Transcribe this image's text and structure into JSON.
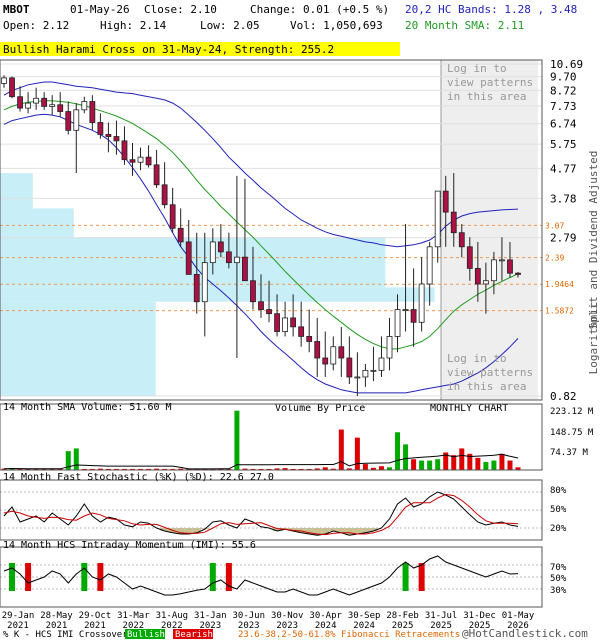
{
  "header": {
    "symbol": "MBOT",
    "date": "01-May-26",
    "close": "Close: 2.10",
    "change": "Change: 0.01 (+0.5 %)",
    "open": "Open: 2.12",
    "high": "High: 2.14",
    "low": "Low: 2.05",
    "vol": "Vol: 1,050,693",
    "bands": "20,2 HC Bands: 1.28 , 3.48",
    "sma": "20 Month SMA: 2.11"
  },
  "colors": {
    "up": "#00aa00",
    "down": "#dd0000",
    "candle_down": "#aa1144",
    "band": "#2222bb",
    "sma": "#229922",
    "volume_zone": "#c8eef8",
    "banner": "#ffff00"
  },
  "banner": "Bullish Harami Cross on 31-May-24, Strength: 255.2",
  "price_panel": {
    "right_label": "Split and Dividend Adjusted",
    "scale_label": "Logarithmic",
    "volume_by_price": "Volume By Price",
    "chart_type": "MONTHLY CHART",
    "pattern_msg_top": [
      "Log in to",
      "view patterns",
      "in this area"
    ],
    "pattern_msg_bottom": [
      "Log in to",
      "view patterns",
      "in this area"
    ],
    "fib_levels": [
      "3.07",
      "2.39",
      "1.9464",
      "1.5872"
    ]
  },
  "volume_panel": {
    "title": "14 Month SMA Volume: 51.60 M",
    "ticks": [
      "223.12 M",
      "148.75 M",
      "74.37 M"
    ]
  },
  "stoch_panel": {
    "title": "14 Month Fast Stochastic (%K) (%D): 22.6   27.0",
    "ticks": [
      "80%",
      "50%",
      "20%"
    ]
  },
  "imi_panel": {
    "title": "14 Month HCS Intraday Momentum (IMI): 55.6",
    "ticks": [
      "70%",
      "50%",
      "30%"
    ]
  },
  "x_labels": [
    [
      "29-Jan",
      "2021"
    ],
    [
      "28-May",
      "2021"
    ],
    [
      "29-Oct",
      "2021"
    ],
    [
      "31-Mar",
      "2022"
    ],
    [
      "31-Aug",
      "2022"
    ],
    [
      "31-Jan",
      "2023"
    ],
    [
      "30-Jun",
      "2023"
    ],
    [
      "30-Nov",
      "2023"
    ],
    [
      "30-Apr",
      "2024"
    ],
    [
      "30-Sep",
      "2024"
    ],
    [
      "28-Feb",
      "2025"
    ],
    [
      "31-Jul",
      "2025"
    ],
    [
      "31-Dec",
      "2025"
    ],
    [
      "01-May",
      "2026"
    ]
  ],
  "footer": {
    "prefix": "% K - HCS IMI Crossover:",
    "bullish": "Bullish",
    "bearish": "Bearish",
    "fib": "23.6-38.2-50-61.8% Fibonacci Retracements",
    "credit": "@HotCandlestick.com"
  },
  "chart_data": {
    "type": "candlestick",
    "yscale": "log",
    "ylim": [
      0.82,
      10.69
    ],
    "y_ticks": [
      10.69,
      9.7,
      8.72,
      7.73,
      6.74,
      5.75,
      4.77,
      3.78,
      2.79,
      0.82
    ],
    "x": [
      "Jan-21",
      "Feb-21",
      "Mar-21",
      "Apr-21",
      "May-21",
      "Jun-21",
      "Jul-21",
      "Aug-21",
      "Sep-21",
      "Oct-21",
      "Nov-21",
      "Dec-21",
      "Jan-22",
      "Feb-22",
      "Mar-22",
      "Apr-22",
      "May-22",
      "Jun-22",
      "Jul-22",
      "Aug-22",
      "Sep-22",
      "Oct-22",
      "Nov-22",
      "Dec-22",
      "Jan-23",
      "Feb-23",
      "Mar-23",
      "Apr-23",
      "May-23",
      "Jun-23",
      "Jul-23",
      "Aug-23",
      "Sep-23",
      "Oct-23",
      "Nov-23",
      "Dec-23",
      "Jan-24",
      "Feb-24",
      "Mar-24",
      "Apr-24",
      "May-24",
      "Jun-24",
      "Jul-24",
      "Aug-24",
      "Sep-24",
      "Oct-24",
      "Nov-24",
      "Dec-24",
      "Jan-25",
      "Feb-25",
      "Mar-25",
      "Apr-25",
      "May-25",
      "Jun-25",
      "Jul-25",
      "Aug-25",
      "Sep-25",
      "Oct-25",
      "Nov-25",
      "Dec-25",
      "Jan-26",
      "Feb-26",
      "Mar-26",
      "Apr-26",
      "May-26"
    ],
    "open": [
      9.2,
      9.6,
      8.3,
      7.6,
      7.9,
      8.2,
      7.7,
      7.8,
      7.4,
      6.4,
      7.5,
      8.0,
      6.8,
      6.2,
      6.1,
      5.9,
      5.1,
      5.0,
      5.2,
      4.9,
      4.2,
      3.6,
      3.0,
      2.7,
      2.1,
      1.7,
      2.3,
      2.7,
      2.5,
      2.3,
      2.4,
      2.0,
      1.7,
      1.6,
      1.55,
      1.35,
      1.5,
      1.4,
      1.3,
      1.25,
      1.1,
      1.05,
      1.2,
      1.1,
      0.95,
      0.95,
      1.0,
      1.0,
      1.1,
      1.3,
      1.6,
      1.6,
      1.45,
      1.95,
      2.6,
      4.0,
      3.4,
      2.9,
      2.6,
      2.2,
      1.95,
      2.0,
      2.35,
      2.35,
      2.12
    ],
    "high": [
      9.8,
      9.7,
      9.0,
      8.6,
      8.9,
      8.6,
      8.4,
      8.6,
      8.0,
      7.9,
      8.3,
      8.4,
      7.3,
      6.8,
      6.9,
      6.6,
      5.8,
      5.6,
      5.7,
      5.5,
      5.0,
      4.1,
      3.5,
      3.2,
      2.9,
      2.9,
      3.0,
      3.1,
      2.9,
      4.5,
      4.4,
      2.6,
      2.1,
      2.0,
      1.8,
      1.7,
      1.8,
      1.7,
      1.6,
      1.5,
      1.35,
      1.3,
      1.4,
      1.3,
      1.15,
      1.05,
      1.2,
      1.3,
      1.5,
      1.8,
      3.1,
      2.2,
      2.4,
      2.7,
      3.1,
      4.5,
      4.6,
      3.1,
      2.8,
      2.7,
      2.3,
      2.5,
      2.8,
      2.7,
      2.14
    ],
    "low": [
      8.9,
      8.2,
      7.4,
      7.3,
      7.5,
      7.5,
      7.2,
      7.1,
      6.2,
      4.6,
      7.3,
      6.4,
      6.0,
      5.4,
      5.3,
      4.9,
      4.5,
      4.7,
      4.8,
      4.1,
      3.5,
      2.9,
      2.6,
      2.1,
      1.55,
      1.3,
      2.1,
      2.4,
      2.2,
      1.1,
      2.3,
      1.6,
      1.5,
      1.45,
      1.3,
      1.3,
      1.3,
      1.2,
      1.15,
      0.95,
      0.95,
      1.0,
      0.95,
      0.9,
      0.82,
      0.88,
      0.92,
      0.95,
      1.0,
      1.15,
      1.35,
      1.2,
      1.35,
      1.65,
      2.3,
      2.6,
      2.6,
      2.4,
      2.0,
      1.7,
      1.55,
      1.8,
      2.0,
      2.05,
      2.05
    ],
    "close": [
      9.6,
      8.3,
      7.6,
      7.9,
      8.2,
      7.7,
      7.8,
      7.4,
      6.4,
      7.5,
      8.0,
      6.8,
      6.2,
      6.1,
      5.9,
      5.1,
      5.0,
      5.2,
      4.9,
      4.2,
      3.6,
      3.0,
      2.7,
      2.1,
      1.7,
      2.3,
      2.7,
      2.5,
      2.3,
      2.4,
      2.0,
      1.7,
      1.6,
      1.55,
      1.35,
      1.5,
      1.4,
      1.3,
      1.25,
      1.1,
      1.05,
      1.2,
      1.1,
      0.95,
      0.95,
      1.0,
      1.0,
      1.1,
      1.3,
      1.6,
      1.6,
      1.45,
      1.95,
      2.6,
      4.0,
      3.4,
      2.9,
      2.6,
      2.2,
      1.95,
      2.0,
      2.35,
      2.35,
      2.12,
      2.1
    ],
    "upper_band": [
      8.4,
      8.7,
      8.9,
      9.1,
      9.2,
      9.3,
      9.3,
      9.2,
      9.1,
      9.0,
      8.95,
      8.9,
      8.8,
      8.7,
      8.6,
      8.55,
      8.5,
      8.4,
      8.3,
      8.2,
      8.1,
      7.9,
      7.6,
      7.2,
      6.8,
      6.4,
      6.0,
      5.6,
      5.2,
      4.9,
      4.6,
      4.35,
      4.1,
      3.9,
      3.7,
      3.5,
      3.35,
      3.2,
      3.1,
      3.0,
      2.92,
      2.86,
      2.82,
      2.78,
      2.74,
      2.7,
      2.68,
      2.64,
      2.62,
      2.6,
      2.62,
      2.64,
      2.68,
      2.74,
      2.86,
      3.05,
      3.2,
      3.3,
      3.36,
      3.4,
      3.42,
      3.44,
      3.46,
      3.47,
      3.48
    ],
    "lower_band": [
      6.7,
      6.9,
      7.0,
      7.1,
      7.2,
      7.25,
      7.2,
      7.1,
      6.9,
      6.7,
      6.55,
      6.4,
      6.2,
      5.95,
      5.6,
      5.2,
      4.8,
      4.4,
      4.0,
      3.6,
      3.25,
      2.9,
      2.6,
      2.4,
      2.2,
      2.05,
      1.95,
      1.85,
      1.75,
      1.65,
      1.55,
      1.45,
      1.35,
      1.27,
      1.2,
      1.14,
      1.08,
      1.02,
      0.97,
      0.93,
      0.9,
      0.88,
      0.86,
      0.85,
      0.84,
      0.84,
      0.84,
      0.84,
      0.84,
      0.84,
      0.84,
      0.85,
      0.86,
      0.87,
      0.88,
      0.89,
      0.9,
      0.92,
      0.95,
      0.98,
      1.02,
      1.07,
      1.13,
      1.2,
      1.28
    ],
    "sma20": [
      7.5,
      7.7,
      7.85,
      7.95,
      8.0,
      8.05,
      8.05,
      8.0,
      7.95,
      7.85,
      7.75,
      7.6,
      7.45,
      7.3,
      7.15,
      6.95,
      6.75,
      6.5,
      6.25,
      6.0,
      5.7,
      5.4,
      5.05,
      4.7,
      4.35,
      4.05,
      3.8,
      3.55,
      3.35,
      3.15,
      2.97,
      2.8,
      2.62,
      2.46,
      2.3,
      2.15,
      2.02,
      1.9,
      1.79,
      1.69,
      1.6,
      1.52,
      1.45,
      1.38,
      1.32,
      1.27,
      1.23,
      1.2,
      1.18,
      1.18,
      1.2,
      1.22,
      1.25,
      1.3,
      1.38,
      1.48,
      1.58,
      1.66,
      1.73,
      1.8,
      1.86,
      1.93,
      1.99,
      2.05,
      2.11
    ],
    "volume_ma_ticks": [
      223.12,
      148.75,
      74.37
    ],
    "volume": [
      5,
      6,
      5,
      4,
      4,
      5,
      4,
      4,
      70,
      80,
      4,
      4,
      5,
      4,
      4,
      4,
      4,
      4,
      4,
      5,
      4,
      4,
      5,
      4,
      4,
      4,
      5,
      5,
      4,
      220,
      5,
      4,
      4,
      4,
      6,
      7,
      4,
      4,
      4,
      6,
      10,
      5,
      150,
      6,
      120,
      22,
      8,
      14,
      10,
      140,
      95,
      40,
      35,
      35,
      40,
      65,
      55,
      80,
      60,
      45,
      30,
      35,
      60,
      35,
      10
    ],
    "volume_up": [
      false,
      true,
      false,
      false,
      false,
      false,
      false,
      false,
      true,
      true,
      false,
      false,
      false,
      false,
      false,
      false,
      false,
      false,
      false,
      false,
      false,
      false,
      false,
      false,
      false,
      false,
      false,
      false,
      false,
      true,
      false,
      false,
      false,
      false,
      false,
      false,
      false,
      false,
      false,
      false,
      false,
      false,
      false,
      false,
      false,
      false,
      false,
      false,
      true,
      true,
      true,
      false,
      true,
      true,
      true,
      false,
      false,
      false,
      false,
      false,
      true,
      true,
      false,
      false,
      false
    ],
    "stoch_k": [
      40,
      55,
      30,
      35,
      40,
      30,
      45,
      35,
      25,
      40,
      60,
      40,
      30,
      38,
      35,
      25,
      22,
      30,
      28,
      20,
      15,
      12,
      10,
      10,
      12,
      18,
      30,
      32,
      25,
      20,
      35,
      30,
      22,
      20,
      15,
      18,
      15,
      12,
      10,
      8,
      10,
      15,
      12,
      8,
      10,
      12,
      15,
      20,
      35,
      60,
      70,
      55,
      60,
      72,
      80,
      75,
      68,
      55,
      42,
      30,
      25,
      28,
      30,
      25,
      22.6
    ],
    "stoch_d": [
      45,
      48,
      45,
      40,
      38,
      36,
      38,
      37,
      34,
      33,
      40,
      45,
      42,
      36,
      34,
      32,
      27,
      25,
      26,
      26,
      21,
      16,
      12,
      11,
      11,
      13,
      20,
      27,
      29,
      26,
      27,
      28,
      29,
      24,
      19,
      18,
      16,
      15,
      12,
      10,
      9,
      11,
      12,
      12,
      10,
      10,
      12,
      16,
      23,
      38,
      55,
      62,
      62,
      62,
      70,
      76,
      74,
      66,
      55,
      42,
      32,
      28,
      28,
      28,
      27.0
    ],
    "imi": [
      60,
      65,
      55,
      40,
      45,
      50,
      60,
      55,
      40,
      55,
      65,
      50,
      45,
      55,
      50,
      40,
      30,
      35,
      30,
      25,
      20,
      20,
      22,
      25,
      28,
      30,
      40,
      45,
      35,
      30,
      45,
      40,
      35,
      30,
      25,
      25,
      30,
      25,
      20,
      20,
      25,
      30,
      25,
      20,
      25,
      30,
      35,
      40,
      50,
      65,
      75,
      65,
      70,
      80,
      85,
      75,
      70,
      65,
      60,
      55,
      50,
      55,
      60,
      55,
      55.6
    ],
    "crossovers": [
      {
        "i": 1,
        "kind": "bullish"
      },
      {
        "i": 3,
        "kind": "bearish"
      },
      {
        "i": 10,
        "kind": "bullish"
      },
      {
        "i": 12,
        "kind": "bearish"
      },
      {
        "i": 26,
        "kind": "bullish"
      },
      {
        "i": 28,
        "kind": "bearish"
      },
      {
        "i": 50,
        "kind": "bullish"
      },
      {
        "i": 52,
        "kind": "bearish"
      }
    ]
  }
}
